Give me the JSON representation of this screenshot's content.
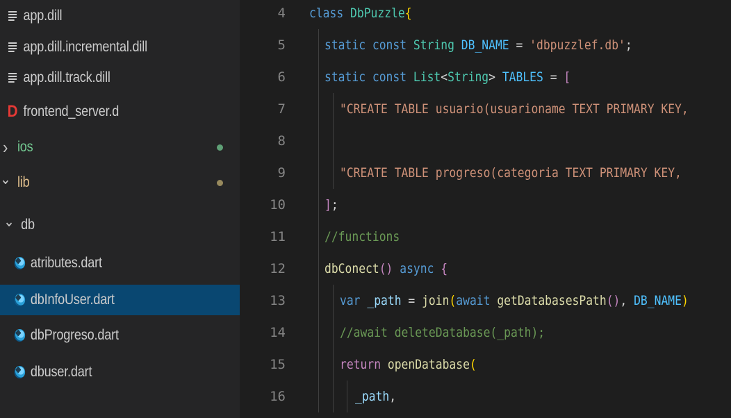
{
  "explorer": {
    "items": [
      {
        "label": "app.dill",
        "icon": "dill-file-icon",
        "kind": "file"
      },
      {
        "label": "app.dill.incremental.dill",
        "icon": "dill-file-icon",
        "kind": "file"
      },
      {
        "label": "app.dill.track.dill",
        "icon": "dill-file-icon",
        "kind": "file"
      },
      {
        "label": "frontend_server.d",
        "icon": "d-file-icon",
        "kind": "file"
      },
      {
        "label": "ios",
        "icon": "chevron-right-icon",
        "kind": "folder",
        "status": "untracked"
      },
      {
        "label": "lib",
        "icon": "chevron-down-icon",
        "kind": "folder",
        "status": "modified"
      },
      {
        "label": "db",
        "icon": "chevron-down-icon",
        "kind": "folder"
      },
      {
        "label": "atributes.dart",
        "icon": "dart-file-icon",
        "kind": "file"
      },
      {
        "label": "dbInfoUser.dart",
        "icon": "dart-file-icon",
        "kind": "file",
        "selected": true
      },
      {
        "label": "dbProgreso.dart",
        "icon": "dart-file-icon",
        "kind": "file"
      },
      {
        "label": "dbuser.dart",
        "icon": "dart-file-icon",
        "kind": "file"
      }
    ]
  },
  "editor": {
    "lines": [
      {
        "n": "4",
        "tokens": [
          [
            "kw",
            "class "
          ],
          [
            "ty",
            "DbPuzzle"
          ],
          [
            "br",
            "{"
          ]
        ]
      },
      {
        "n": "5",
        "tokens": [
          [
            "kw",
            "static const "
          ],
          [
            "ty",
            "String "
          ],
          [
            "cn",
            "DB_NAME"
          ],
          [
            "pl",
            " = "
          ],
          [
            "st",
            "'dbpuzzlef.db'"
          ],
          [
            "pl",
            ";"
          ]
        ]
      },
      {
        "n": "6",
        "tokens": [
          [
            "kw",
            "static const "
          ],
          [
            "ty",
            "List"
          ],
          [
            "pl",
            "<"
          ],
          [
            "ty",
            "String"
          ],
          [
            "pl",
            "> "
          ],
          [
            "cn",
            "TABLES"
          ],
          [
            "pl",
            " = "
          ],
          [
            "ct",
            "["
          ]
        ]
      },
      {
        "n": "7",
        "tokens": [
          [
            "st",
            "\"CREATE TABLE usuario(usuarioname TEXT PRIMARY KEY, "
          ]
        ]
      },
      {
        "n": "8",
        "tokens": []
      },
      {
        "n": "9",
        "tokens": [
          [
            "st",
            "\"CREATE TABLE progreso(categoria TEXT PRIMARY KEY, "
          ]
        ]
      },
      {
        "n": "10",
        "tokens": [
          [
            "ct",
            "]"
          ],
          [
            "pl",
            ";"
          ]
        ]
      },
      {
        "n": "11",
        "tokens": [
          [
            "cm",
            "//functions"
          ]
        ]
      },
      {
        "n": "12",
        "tokens": [
          [
            "fn",
            "dbConect"
          ],
          [
            "ct",
            "()"
          ],
          [
            "pl",
            " "
          ],
          [
            "kw",
            "async"
          ],
          [
            "pl",
            " "
          ],
          [
            "ct",
            "{"
          ]
        ]
      },
      {
        "n": "13",
        "tokens": [
          [
            "kw",
            "var "
          ],
          [
            "va",
            "_path"
          ],
          [
            "pl",
            " = "
          ],
          [
            "fn",
            "join"
          ],
          [
            "br",
            "("
          ],
          [
            "kw",
            "await "
          ],
          [
            "fn",
            "getDatabasesPath"
          ],
          [
            "ct",
            "()"
          ],
          [
            "pl",
            ", "
          ],
          [
            "cn",
            "DB_NAME"
          ],
          [
            "br",
            ")"
          ]
        ]
      },
      {
        "n": "14",
        "tokens": [
          [
            "cm",
            "//await deleteDatabase(_path);"
          ]
        ]
      },
      {
        "n": "15",
        "tokens": [
          [
            "ct",
            "return "
          ],
          [
            "fn",
            "openDatabase"
          ],
          [
            "br",
            "("
          ]
        ]
      },
      {
        "n": "16",
        "tokens": [
          [
            "va",
            "_path"
          ],
          [
            "pl",
            ","
          ]
        ]
      }
    ]
  }
}
